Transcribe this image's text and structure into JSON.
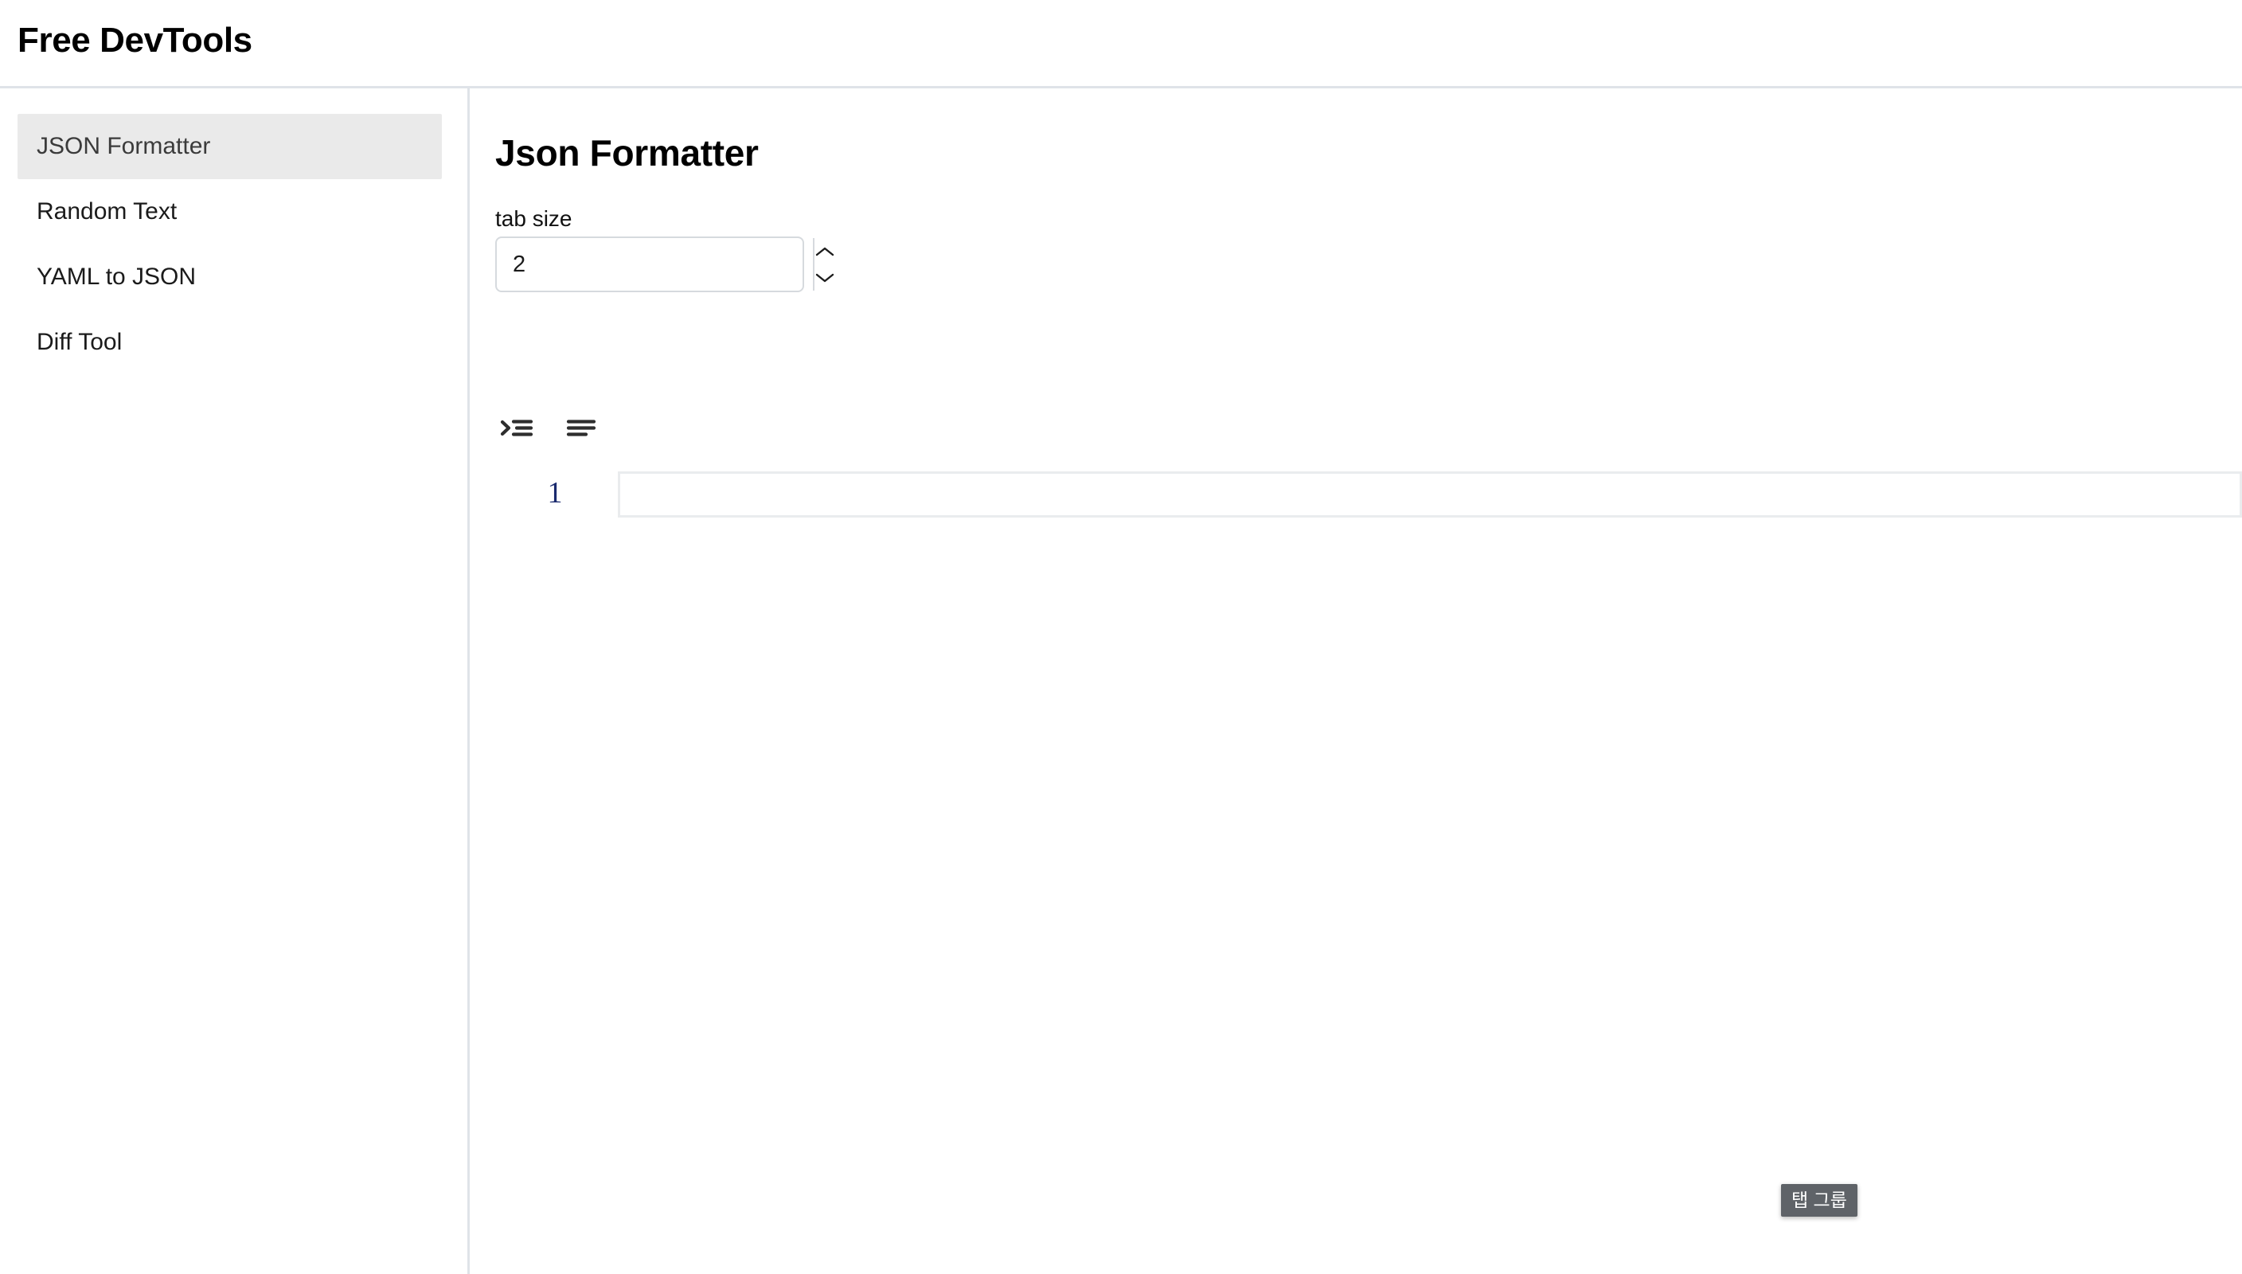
{
  "header": {
    "app_title": "Free DevTools"
  },
  "sidebar": {
    "items": [
      {
        "label": "JSON Formatter",
        "active": true
      },
      {
        "label": "Random Text",
        "active": false
      },
      {
        "label": "YAML to JSON",
        "active": false
      },
      {
        "label": "Diff Tool",
        "active": false
      }
    ]
  },
  "main": {
    "panel_title": "Json Formatter",
    "tab_size": {
      "label": "tab size",
      "value": "2",
      "placeholder": "tab size",
      "increment_icon": "chevron-up-icon",
      "decrement_icon": "chevron-down-icon"
    },
    "toolbar": {
      "buttons": [
        {
          "name": "format-indent-button",
          "icon": "indent-increase-icon",
          "label": ""
        },
        {
          "name": "minify-button",
          "icon": "align-left-icon",
          "label": ""
        }
      ]
    },
    "editor": {
      "lines": [
        {
          "number": "1",
          "value": "",
          "placeholder": ""
        }
      ]
    }
  },
  "tooltip": {
    "text": "탭 그룹"
  },
  "colors": {
    "active_item_background": "#eaeaea",
    "divider": "#dfe3e8",
    "line_number": "#1a2a6e",
    "tooltip_background": "#5f6368",
    "editor_border": "#eaecee"
  }
}
